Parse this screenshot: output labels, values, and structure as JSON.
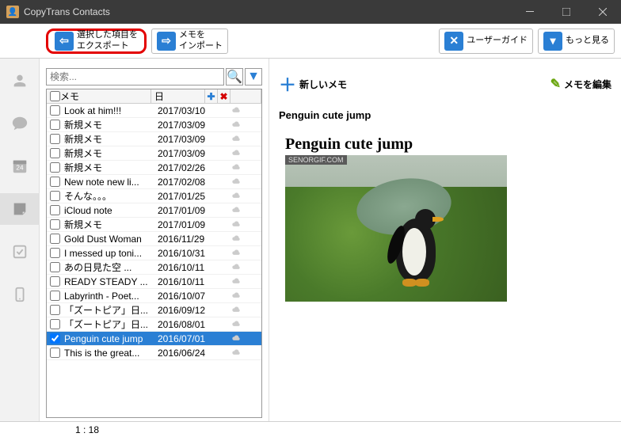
{
  "window": {
    "title": "CopyTrans Contacts"
  },
  "toolbar": {
    "export_label": "選択した項目を\nエクスポート",
    "import_label": "メモを\nインポート",
    "userguide_label": "ユーザーガイド",
    "more_label": "もっと見る"
  },
  "search": {
    "placeholder": "検索..."
  },
  "list": {
    "header_title": "メモ",
    "header_date": "日",
    "rows": [
      {
        "title": "Look at him!!!",
        "date": "2017/03/10",
        "checked": false
      },
      {
        "title": "新規メモ",
        "date": "2017/03/09",
        "checked": false
      },
      {
        "title": "新規メモ",
        "date": "2017/03/09",
        "checked": false
      },
      {
        "title": "新規メモ",
        "date": "2017/03/09",
        "checked": false
      },
      {
        "title": "新規メモ",
        "date": "2017/02/26",
        "checked": false
      },
      {
        "title": "New note new li...",
        "date": "2017/02/08",
        "checked": false
      },
      {
        "title": "そんな。。。",
        "date": "2017/01/25",
        "checked": false
      },
      {
        "title": "iCloud note",
        "date": "2017/01/09",
        "checked": false
      },
      {
        "title": "新規メモ",
        "date": "2017/01/09",
        "checked": false
      },
      {
        "title": "Gold Dust Woman",
        "date": "2016/11/29",
        "checked": false
      },
      {
        "title": "I messed up toni...",
        "date": "2016/10/31",
        "checked": false
      },
      {
        "title": "あの日見た空 ...",
        "date": "2016/10/11",
        "checked": false
      },
      {
        "title": "READY STEADY ...",
        "date": "2016/10/11",
        "checked": false
      },
      {
        "title": "Labyrinth - Poet...",
        "date": "2016/10/07",
        "checked": false
      },
      {
        "title": "「ズートピア」日...",
        "date": "2016/09/12",
        "checked": false
      },
      {
        "title": "「ズートピア」日...",
        "date": "2016/08/01",
        "checked": false
      },
      {
        "title": "Penguin cute jump",
        "date": "2016/07/01",
        "checked": true,
        "selected": true
      },
      {
        "title": "This is the great...",
        "date": "2016/06/24",
        "checked": false
      }
    ]
  },
  "right": {
    "new_label": "新しいメモ",
    "edit_label": "メモを編集",
    "note_title": "Penguin cute jump",
    "note_body": "Penguin cute jump",
    "watermark": "SENORGIF.COM"
  },
  "status": {
    "counter": "1 : 18"
  },
  "nav": {
    "calendar_day": "24"
  }
}
